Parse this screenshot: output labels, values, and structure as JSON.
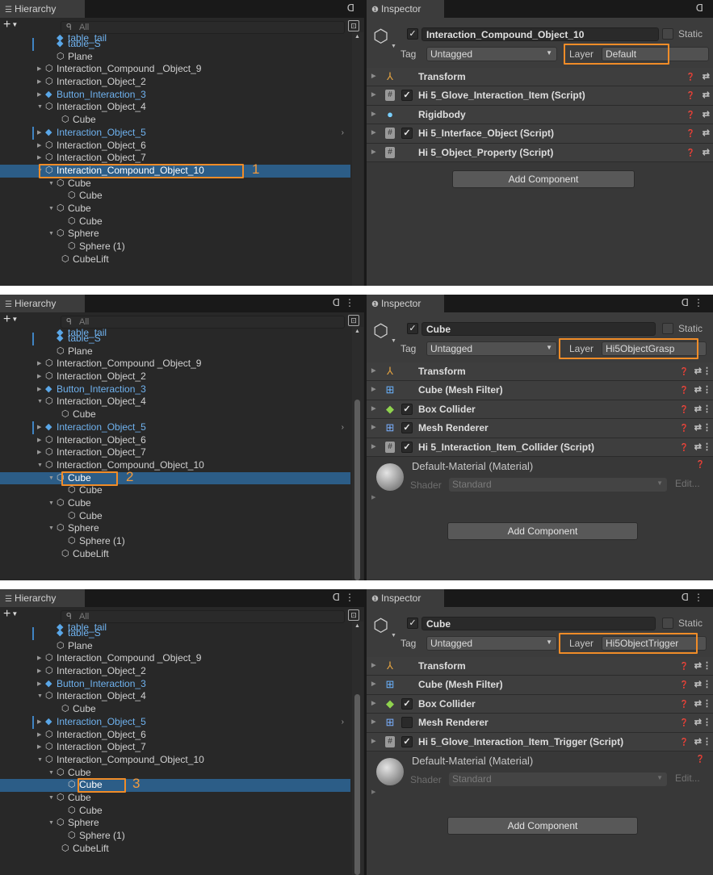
{
  "hierarchy": {
    "tab_label": "Hierarchy",
    "add_label": "+",
    "search_placeholder": "All"
  },
  "inspector": {
    "tab_label": "Inspector",
    "tag_label": "Tag",
    "layer_label": "Layer",
    "static_label": "Static",
    "add_component_label": "Add Component",
    "shader_label": "Shader",
    "edit_label": "Edit..."
  },
  "icons": {
    "gameobject": "cube-outline-icon",
    "prefab": "blue-cube-icon",
    "transform": "transform-axes-icon",
    "script": "script-hash-icon",
    "rigidbody": "rigidbody-icon",
    "mesh_filter": "mesh-grid-icon",
    "box_collider": "box-collider-icon",
    "mesh_renderer": "mesh-renderer-icon"
  },
  "colors": {
    "callout": "#f08c28",
    "selection": "#2c5d87",
    "prefab_text": "#6fb2ef"
  },
  "screens": [
    {
      "callout_number": "1",
      "tree_rows": [
        {
          "name": "table_tail",
          "prefab": true
        },
        {
          "name": "table_S",
          "prefab": true
        },
        {
          "name": "Plane"
        },
        {
          "name": "Interaction_Compound _Object_9"
        },
        {
          "name": "Interaction_Object_2"
        },
        {
          "name": "Button_Interaction_3",
          "prefab": true
        },
        {
          "name": "Interaction_Object_4"
        },
        {
          "name": "Cube"
        },
        {
          "name": "Interaction_Object_5",
          "prefab": true
        },
        {
          "name": "Interaction_Object_6"
        },
        {
          "name": "Interaction_Object_7"
        },
        {
          "name": "Interaction_Compound_Object_10",
          "selected": true
        },
        {
          "name": "Cube"
        },
        {
          "name": "Cube"
        },
        {
          "name": "Cube"
        },
        {
          "name": "Cube"
        },
        {
          "name": "Sphere"
        },
        {
          "name": "Sphere (1)"
        },
        {
          "name": "CubeLift"
        }
      ],
      "object_name": "Interaction_Compound_Object_10",
      "tag_value": "Untagged",
      "layer_value": "Default",
      "components": [
        {
          "name": "Transform",
          "icon": "transform",
          "checkbox": false
        },
        {
          "name": "Hi 5_Glove_Interaction_Item (Script)",
          "icon": "script",
          "checkbox": true,
          "checked": true
        },
        {
          "name": "Rigidbody",
          "icon": "rigidbody",
          "checkbox": false
        },
        {
          "name": "Hi 5_Interface_Object (Script)",
          "icon": "script",
          "checkbox": true,
          "checked": true
        },
        {
          "name": "Hi 5_Object_Property (Script)",
          "icon": "script",
          "checkbox": false
        }
      ]
    },
    {
      "callout_number": "2",
      "tree_rows": [
        {
          "name": "table_tail",
          "prefab": true
        },
        {
          "name": "table_S",
          "prefab": true
        },
        {
          "name": "Plane"
        },
        {
          "name": "Interaction_Compound _Object_9"
        },
        {
          "name": "Interaction_Object_2"
        },
        {
          "name": "Button_Interaction_3",
          "prefab": true
        },
        {
          "name": "Interaction_Object_4"
        },
        {
          "name": "Cube"
        },
        {
          "name": "Interaction_Object_5",
          "prefab": true
        },
        {
          "name": "Interaction_Object_6"
        },
        {
          "name": "Interaction_Object_7"
        },
        {
          "name": "Interaction_Compound_Object_10"
        },
        {
          "name": "Cube",
          "selected": true
        },
        {
          "name": "Cube"
        },
        {
          "name": "Cube"
        },
        {
          "name": "Cube"
        },
        {
          "name": "Sphere"
        },
        {
          "name": "Sphere (1)"
        },
        {
          "name": "CubeLift"
        }
      ],
      "object_name": "Cube",
      "tag_value": "Untagged",
      "layer_value": "Hi5ObjectGrasp",
      "components": [
        {
          "name": "Transform",
          "icon": "transform",
          "checkbox": false
        },
        {
          "name": "Cube (Mesh Filter)",
          "icon": "mesh_filter",
          "checkbox": false
        },
        {
          "name": "Box Collider",
          "icon": "box_collider",
          "checkbox": true,
          "checked": true
        },
        {
          "name": "Mesh Renderer",
          "icon": "mesh_renderer",
          "checkbox": true,
          "checked": true
        },
        {
          "name": "Hi 5_Interaction_Item_Collider (Script)",
          "icon": "script",
          "checkbox": true,
          "checked": true
        }
      ],
      "material": {
        "name": "Default-Material (Material)",
        "shader": "Standard"
      }
    },
    {
      "callout_number": "3",
      "tree_rows": [
        {
          "name": "table_tail",
          "prefab": true
        },
        {
          "name": "table_S",
          "prefab": true
        },
        {
          "name": "Plane"
        },
        {
          "name": "Interaction_Compound _Object_9"
        },
        {
          "name": "Interaction_Object_2"
        },
        {
          "name": "Button_Interaction_3",
          "prefab": true
        },
        {
          "name": "Interaction_Object_4"
        },
        {
          "name": "Cube"
        },
        {
          "name": "Interaction_Object_5",
          "prefab": true
        },
        {
          "name": "Interaction_Object_6"
        },
        {
          "name": "Interaction_Object_7"
        },
        {
          "name": "Interaction_Compound_Object_10"
        },
        {
          "name": "Cube"
        },
        {
          "name": "Cube",
          "selected": true
        },
        {
          "name": "Cube"
        },
        {
          "name": "Cube"
        },
        {
          "name": "Sphere"
        },
        {
          "name": "Sphere (1)"
        },
        {
          "name": "CubeLift"
        }
      ],
      "object_name": "Cube",
      "tag_value": "Untagged",
      "layer_value": "Hi5ObjectTrigger",
      "components": [
        {
          "name": "Transform",
          "icon": "transform",
          "checkbox": false
        },
        {
          "name": "Cube (Mesh Filter)",
          "icon": "mesh_filter",
          "checkbox": false
        },
        {
          "name": "Box Collider",
          "icon": "box_collider",
          "checkbox": true,
          "checked": true
        },
        {
          "name": "Mesh Renderer",
          "icon": "mesh_renderer",
          "checkbox": true,
          "checked": false
        },
        {
          "name": "Hi 5_Glove_Interaction_Item_Trigger (Script)",
          "icon": "script",
          "checkbox": true,
          "checked": true
        }
      ],
      "material": {
        "name": "Default-Material (Material)",
        "shader": "Standard"
      }
    }
  ]
}
